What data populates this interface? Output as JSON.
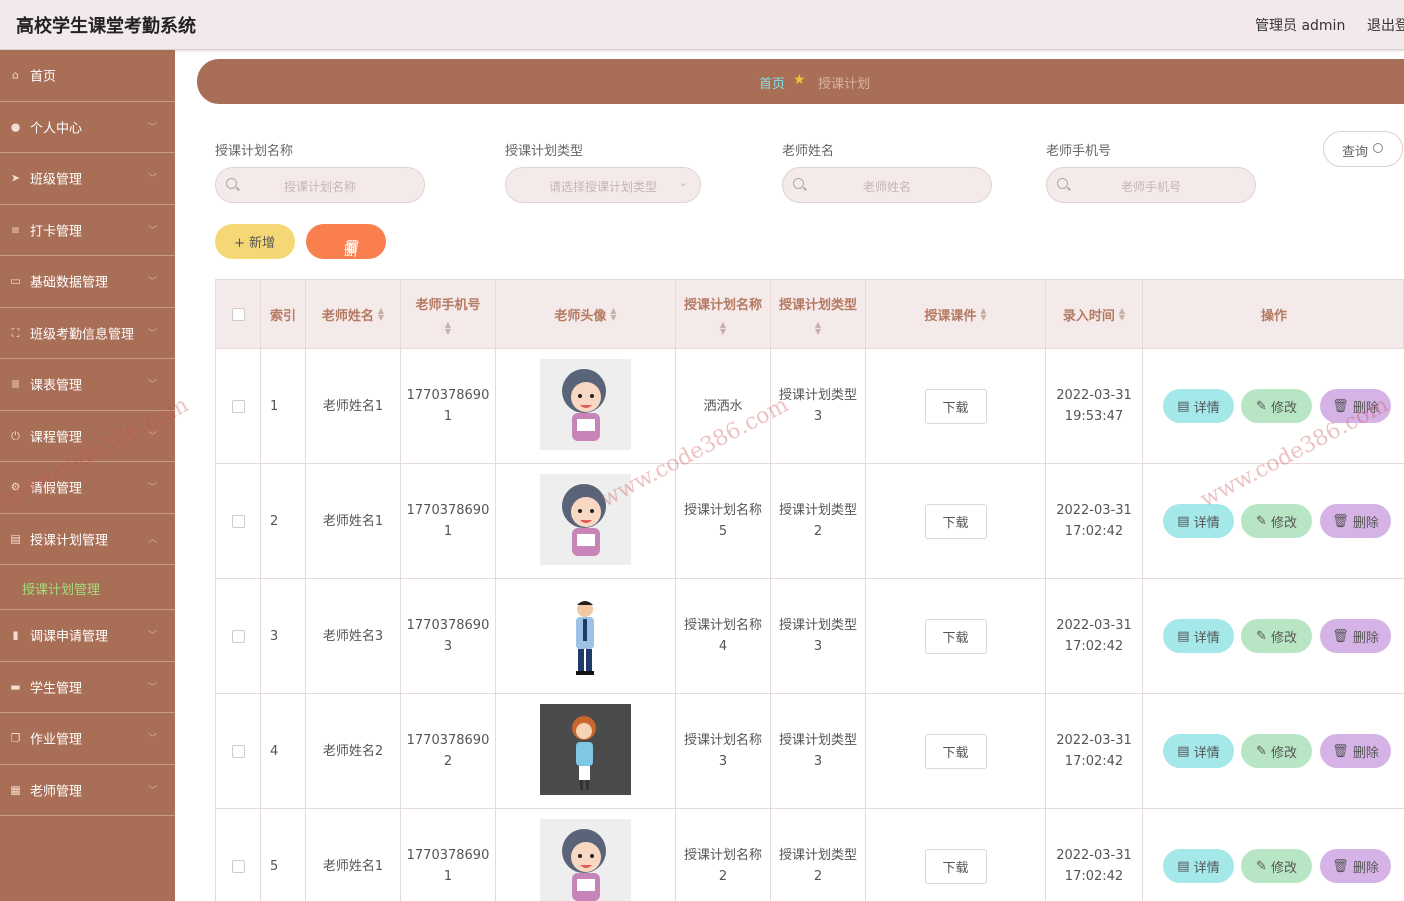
{
  "header": {
    "title": "高校学生课堂考勤系统",
    "user": "管理员 admin",
    "logout": "退出登"
  },
  "sidebar": {
    "items": [
      {
        "label": "首页",
        "icon": "home-icon"
      },
      {
        "label": "个人中心",
        "icon": "user-icon"
      },
      {
        "label": "班级管理",
        "icon": "send-icon"
      },
      {
        "label": "打卡管理",
        "icon": "list-icon"
      },
      {
        "label": "基础数据管理",
        "icon": "message-icon"
      },
      {
        "label": "班级考勤信息管理",
        "icon": "frame-icon"
      },
      {
        "label": "课表管理",
        "icon": "stack-icon"
      },
      {
        "label": "课程管理",
        "icon": "power-icon"
      },
      {
        "label": "请假管理",
        "icon": "gear-icon"
      },
      {
        "label": "授课计划管理",
        "icon": "doc-icon"
      },
      {
        "label": "调课申请管理",
        "icon": "chart-icon"
      },
      {
        "label": "学生管理",
        "icon": "monitor-icon"
      },
      {
        "label": "作业管理",
        "icon": "copy-icon"
      },
      {
        "label": "老师管理",
        "icon": "card-icon"
      }
    ],
    "active_sub": "授课计划管理"
  },
  "breadcrumb": {
    "home": "首页",
    "current": "授课计划"
  },
  "filters": {
    "name_label": "授课计划名称",
    "name_placeholder": "授课计划名称",
    "type_label": "授课计划类型",
    "type_placeholder": "请选择授课计划类型",
    "teacher_label": "老师姓名",
    "teacher_placeholder": "老师姓名",
    "phone_label": "老师手机号",
    "phone_placeholder": "老师手机号",
    "query": "查询"
  },
  "actions": {
    "add": "+ 新增",
    "delete": "删除"
  },
  "table": {
    "headers": {
      "index": "索引",
      "teacher": "老师姓名",
      "phone": "老师手机号",
      "avatar": "老师头像",
      "plan_name": "授课计划名称",
      "plan_type": "授课计划类型",
      "courseware": "授课课件",
      "time": "录入时间",
      "ops": "操作"
    },
    "rows": [
      {
        "index": "1",
        "teacher": "老师姓名1",
        "phone_a": "1770378690",
        "phone_b": "1",
        "avatar": "girl-teacher-icon",
        "plan_a": "洒洒水",
        "plan_b": "",
        "type_a": "授课计划类型",
        "type_b": "3",
        "download": "下载",
        "date": "2022-03-31",
        "clock": "19:53:47"
      },
      {
        "index": "2",
        "teacher": "老师姓名1",
        "phone_a": "1770378690",
        "phone_b": "1",
        "avatar": "girl-teacher-icon",
        "plan_a": "授课计划名称",
        "plan_b": "5",
        "type_a": "授课计划类型",
        "type_b": "2",
        "download": "下载",
        "date": "2022-03-31",
        "clock": "17:02:42"
      },
      {
        "index": "3",
        "teacher": "老师姓名3",
        "phone_a": "1770378690",
        "phone_b": "3",
        "avatar": "man-teacher-icon",
        "plan_a": "授课计划名称",
        "plan_b": "4",
        "type_a": "授课计划类型",
        "type_b": "3",
        "download": "下载",
        "date": "2022-03-31",
        "clock": "17:02:42"
      },
      {
        "index": "4",
        "teacher": "老师姓名2",
        "phone_a": "1770378690",
        "phone_b": "2",
        "avatar": "woman-teacher-icon",
        "plan_a": "授课计划名称",
        "plan_b": "3",
        "type_a": "授课计划类型",
        "type_b": "3",
        "download": "下载",
        "date": "2022-03-31",
        "clock": "17:02:42"
      },
      {
        "index": "5",
        "teacher": "老师姓名1",
        "phone_a": "1770378690",
        "phone_b": "1",
        "avatar": "girl-teacher-icon",
        "plan_a": "授课计划名称",
        "plan_b": "2",
        "type_a": "授课计划类型",
        "type_b": "2",
        "download": "下载",
        "date": "2022-03-31",
        "clock": "17:02:42"
      }
    ],
    "op_labels": {
      "detail": "详情",
      "edit": "修改",
      "delete": "删除"
    }
  },
  "watermark": "www.code386.com",
  "colors": {
    "sidebar": "#a96e56",
    "header_bg": "#f3e9ea",
    "add": "#f5d775",
    "delete": "#f97f4e",
    "detail": "#a4e8ea",
    "edit": "#b8e6c4",
    "del_row": "#d6b3e6",
    "active": "#9fe07a"
  }
}
